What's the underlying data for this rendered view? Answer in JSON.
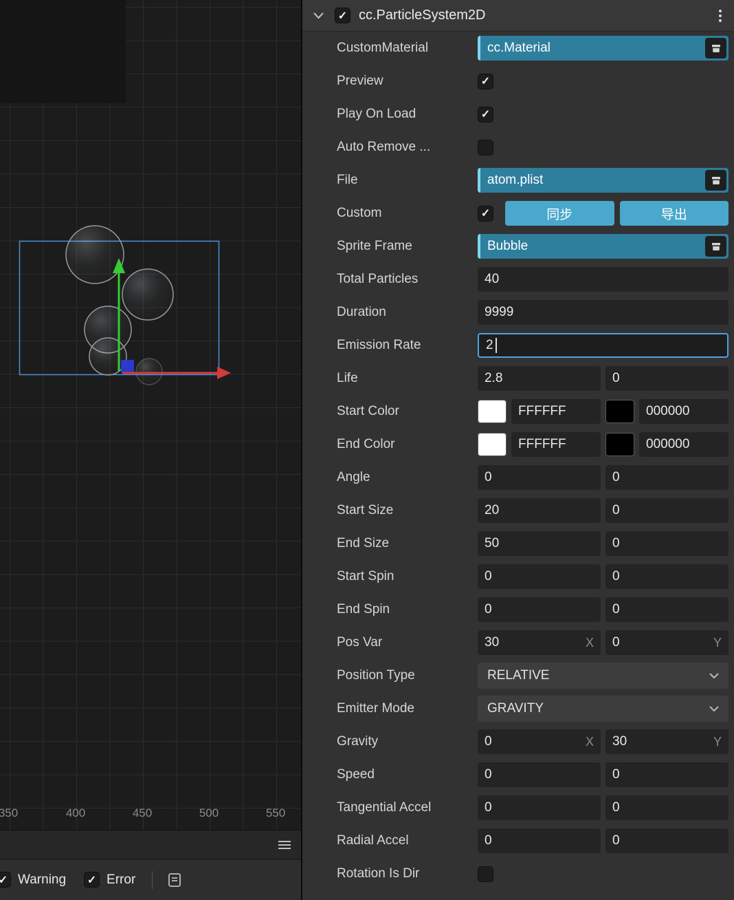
{
  "icons": {
    "check": "✓"
  },
  "colors": {
    "focus_border": "#4da3e0",
    "asset_field_bg": "#2e7e9d",
    "asset_accent": "#7fd6ec",
    "action_button_bg": "#49a8cc",
    "selection_outline": "#4a8fd6",
    "axis_x": "#d63a3a",
    "axis_y": "#35cc35",
    "axis_plane": "#2b3bd6"
  },
  "scene": {
    "ruler": {
      "labels": [
        "350",
        "400",
        "450",
        "500",
        "550"
      ]
    },
    "statusbar": {
      "warning": {
        "label": "Warning",
        "checked": true
      },
      "error": {
        "label": "Error",
        "checked": true
      }
    }
  },
  "inspector": {
    "header": {
      "title": "cc.ParticleSystem2D",
      "enabled": true
    },
    "fields": {
      "custom_material": {
        "label": "CustomMaterial",
        "value": "cc.Material"
      },
      "preview": {
        "label": "Preview",
        "checked": true
      },
      "play_on_load": {
        "label": "Play On Load",
        "checked": true
      },
      "auto_remove": {
        "label": "Auto Remove ...",
        "checked": false
      },
      "file": {
        "label": "File",
        "value": "atom.plist"
      },
      "custom": {
        "label": "Custom",
        "checked": true,
        "sync_label": "同步",
        "export_label": "导出"
      },
      "sprite_frame": {
        "label": "Sprite Frame",
        "value": "Bubble"
      },
      "total_particles": {
        "label": "Total Particles",
        "value": "40"
      },
      "duration": {
        "label": "Duration",
        "value": "9999"
      },
      "emission_rate": {
        "label": "Emission Rate",
        "value": "2",
        "focused": true
      },
      "life": {
        "label": "Life",
        "value": "2.8",
        "variance": "0"
      },
      "start_color": {
        "label": "Start Color",
        "color": "#FFFFFF",
        "hex": "FFFFFF",
        "variance_color": "#000000",
        "variance_hex": "000000"
      },
      "end_color": {
        "label": "End Color",
        "color": "#FFFFFF",
        "hex": "FFFFFF",
        "variance_color": "#000000",
        "variance_hex": "000000"
      },
      "angle": {
        "label": "Angle",
        "value": "0",
        "variance": "0"
      },
      "start_size": {
        "label": "Start Size",
        "value": "20",
        "variance": "0"
      },
      "end_size": {
        "label": "End Size",
        "value": "50",
        "variance": "0"
      },
      "start_spin": {
        "label": "Start Spin",
        "value": "0",
        "variance": "0"
      },
      "end_spin": {
        "label": "End Spin",
        "value": "0",
        "variance": "0"
      },
      "pos_var": {
        "label": "Pos Var",
        "x": "30",
        "y": "0",
        "x_suffix": "X",
        "y_suffix": "Y"
      },
      "position_type": {
        "label": "Position Type",
        "value": "RELATIVE"
      },
      "emitter_mode": {
        "label": "Emitter Mode",
        "value": "GRAVITY"
      },
      "gravity": {
        "label": "Gravity",
        "x": "0",
        "y": "30",
        "x_suffix": "X",
        "y_suffix": "Y"
      },
      "speed": {
        "label": "Speed",
        "value": "0",
        "variance": "0"
      },
      "tangential_accel": {
        "label": "Tangential Accel",
        "value": "0",
        "variance": "0"
      },
      "radial_accel": {
        "label": "Radial Accel",
        "value": "0",
        "variance": "0"
      },
      "rotation_is_dir": {
        "label": "Rotation Is Dir",
        "checked": false
      }
    }
  }
}
